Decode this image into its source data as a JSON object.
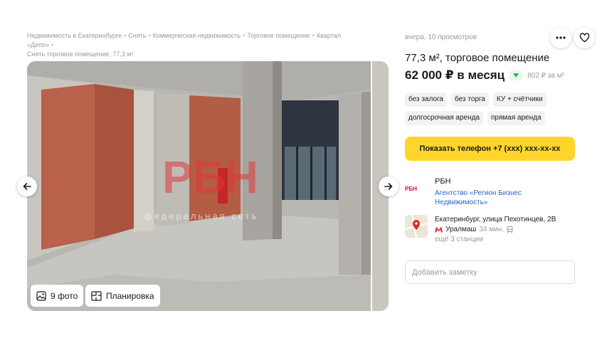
{
  "breadcrumb": {
    "items": [
      "Недвижимость в Екатеринбурге",
      "Снять",
      "Коммерческая недвижимость",
      "Торговое помещение",
      "Квартал «Депо»",
      "Снять торговое помещение, 77,3 м²"
    ],
    "separator": "•"
  },
  "gallery": {
    "watermark_logo": "РБН",
    "watermark_text": "федеральная сеть",
    "photos_button": {
      "icon": "image-icon",
      "label": "9 фото"
    },
    "plan_button": {
      "icon": "floor-plan-icon",
      "label": "Планировка"
    },
    "prev_icon": "arrow-left-icon",
    "next_icon": "arrow-right-icon"
  },
  "listing": {
    "meta": "вчера, 10 просмотров",
    "title": "77,3 м², торговое помещение",
    "price": "62 000 ₽ в месяц",
    "price_trend_icon": "triangle-down-icon",
    "price_per_m2": "802 ₽ за м²",
    "tags": [
      "без залога",
      "без торга",
      "КУ + счётчики",
      "долгосрочная аренда",
      "прямая аренда"
    ],
    "call_button": "Показать телефон +7 (xxx) xxx-xx-xx"
  },
  "agency": {
    "logo_text": "РБН",
    "name": "РБН",
    "full_name": "Агентство «Регион Бизнес Недвижимость»"
  },
  "location": {
    "address": "Екатеринбург, улица Пехотинцев, 2В",
    "metro_station": "Уралмаш",
    "metro_time": "34 мин.",
    "more_stations": "ещё 3 станции"
  },
  "note": {
    "placeholder": "Добавить заметку"
  },
  "colors": {
    "accent_yellow": "#ffd52b",
    "link_blue": "#2b66c6",
    "metro_red": "#e0262b",
    "trend_green": "#2bb24c",
    "brand_red": "#c8102e"
  }
}
